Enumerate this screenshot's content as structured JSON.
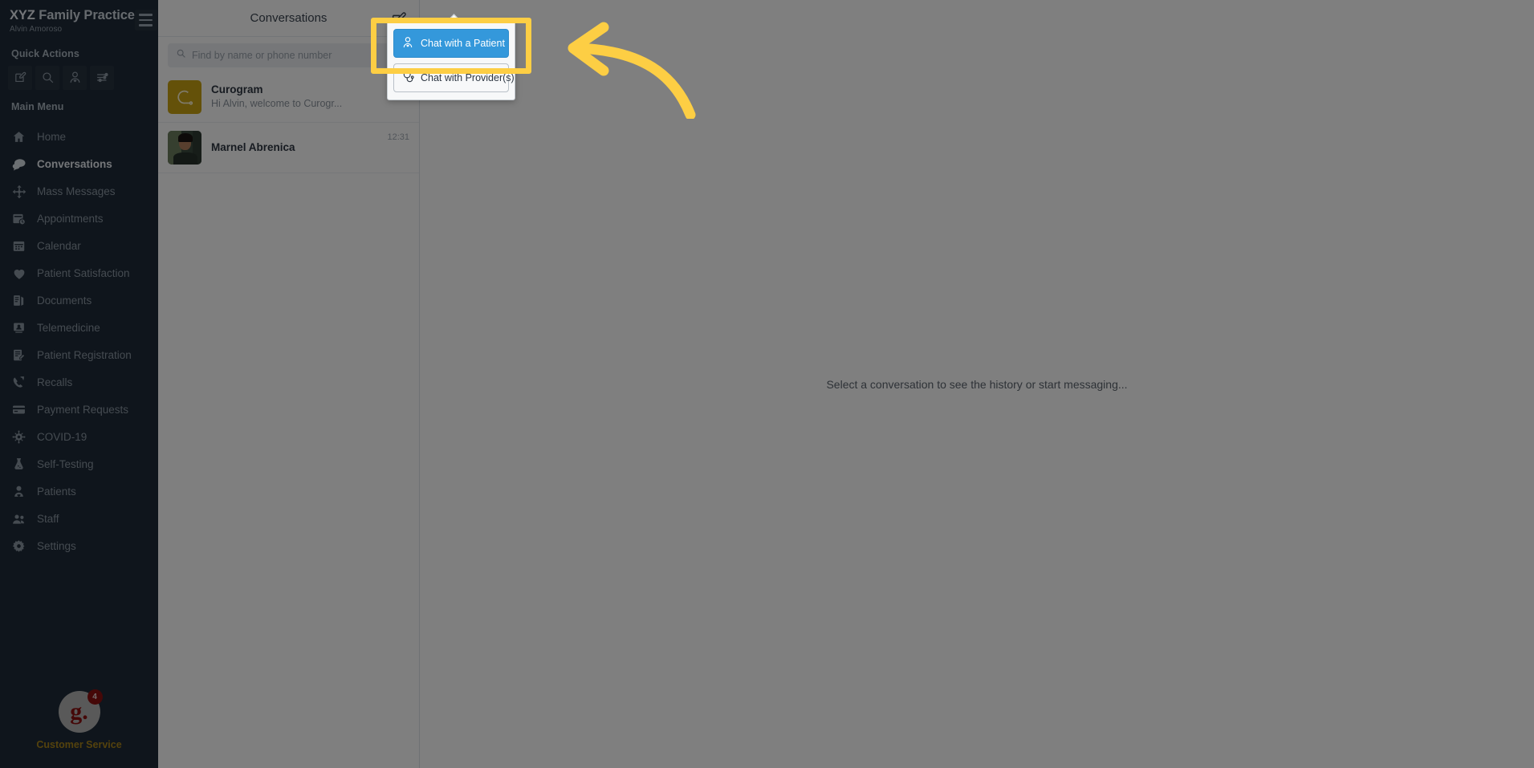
{
  "sidebar": {
    "brand_primary": "XYZ",
    "brand_rest": " Family Practice",
    "user_name": "Alvin Amoroso",
    "hamburger_icon": "hamburger-icon",
    "quick_actions_label": "Quick Actions",
    "quick_actions": [
      {
        "name": "compose-message-icon",
        "title": "Compose"
      },
      {
        "name": "search-icon",
        "title": "Search"
      },
      {
        "name": "patient-icon",
        "title": "Patient"
      },
      {
        "name": "filter-sliders-icon",
        "title": "Filters"
      }
    ],
    "main_menu_label": "Main Menu",
    "items": [
      {
        "label": "Home",
        "icon": "home-icon",
        "active": false
      },
      {
        "label": "Conversations",
        "icon": "chat-bubbles-icon",
        "active": true
      },
      {
        "label": "Mass Messages",
        "icon": "broadcast-arrows-icon",
        "active": false
      },
      {
        "label": "Appointments",
        "icon": "calendar-clock-icon",
        "active": false
      },
      {
        "label": "Calendar",
        "icon": "calendar-icon",
        "active": false
      },
      {
        "label": "Patient Satisfaction",
        "icon": "heart-icon",
        "active": false
      },
      {
        "label": "Documents",
        "icon": "documents-icon",
        "active": false
      },
      {
        "label": "Telemedicine",
        "icon": "telemedicine-icon",
        "active": false
      },
      {
        "label": "Patient Registration",
        "icon": "form-pencil-icon",
        "active": false
      },
      {
        "label": "Recalls",
        "icon": "phone-refresh-icon",
        "active": false
      },
      {
        "label": "Payment Requests",
        "icon": "credit-card-icon",
        "active": false
      },
      {
        "label": "COVID-19",
        "icon": "virus-icon",
        "active": false
      },
      {
        "label": "Self-Testing",
        "icon": "test-flask-icon",
        "active": false
      },
      {
        "label": "Patients",
        "icon": "patient-icon",
        "active": false
      },
      {
        "label": "Staff",
        "icon": "staff-group-icon",
        "active": false
      },
      {
        "label": "Settings",
        "icon": "gear-icon",
        "active": false
      }
    ],
    "footer": {
      "logo_letter": "g.",
      "badge_count": "4",
      "label": "Customer Service"
    }
  },
  "conversations_panel": {
    "title": "Conversations",
    "compose_icon": "compose-new-conversation-icon",
    "search": {
      "placeholder": "Find by name or phone number",
      "value": "",
      "icon": "search-icon"
    },
    "items": [
      {
        "name": "Curogram",
        "snippet": "Hi Alvin, welcome to Curogr...",
        "time": "",
        "avatar_type": "brand",
        "avatar_icon": "curogram-logo-icon"
      },
      {
        "name": "Marnel Abrenica",
        "snippet": "",
        "time": "12:31",
        "avatar_type": "photo",
        "avatar_icon": "user-photo-avatar"
      }
    ]
  },
  "main": {
    "empty_hint": "Select a conversation to see the history or start messaging..."
  },
  "popup_menu": {
    "items": [
      {
        "label": "Chat with a Patient",
        "icon": "patient-icon",
        "selected": true
      },
      {
        "label": "Chat with Provider(s)",
        "icon": "stethoscope-icon",
        "selected": false
      }
    ]
  },
  "annotations": {
    "highlight_color": "#fdce44",
    "arrow_color": "#fdce44",
    "highlight_target": "Chat with a Patient",
    "arrow_icon": "curved-left-arrow-annotation"
  },
  "colors": {
    "sidebar_bg": "#1f2b38",
    "accent_blue": "#3498db",
    "brand_gold": "#c9a313",
    "annotation_yellow": "#fdce44",
    "customer_service_label": "#a8841a"
  }
}
